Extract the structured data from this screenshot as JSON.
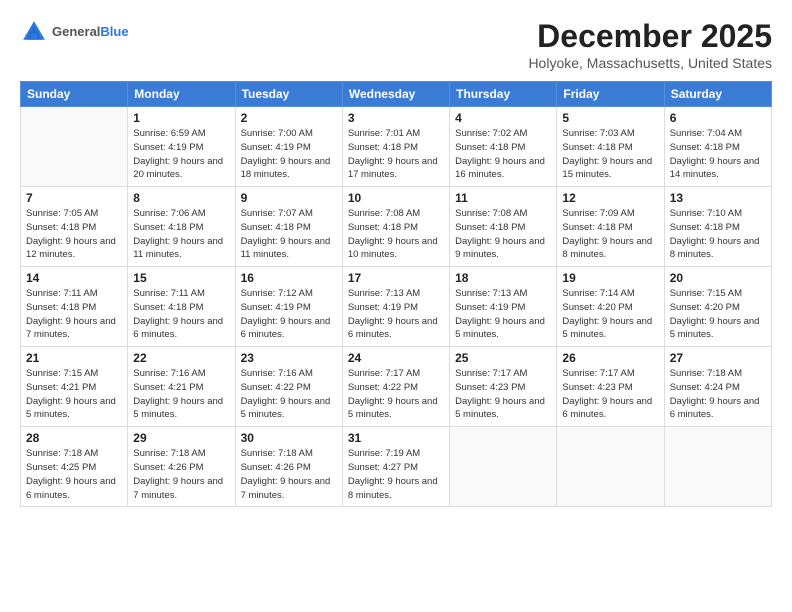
{
  "header": {
    "logo_general": "General",
    "logo_blue": "Blue",
    "month": "December 2025",
    "location": "Holyoke, Massachusetts, United States"
  },
  "days_of_week": [
    "Sunday",
    "Monday",
    "Tuesday",
    "Wednesday",
    "Thursday",
    "Friday",
    "Saturday"
  ],
  "weeks": [
    [
      {
        "day": "",
        "sunrise": "",
        "sunset": "",
        "daylight": ""
      },
      {
        "day": "1",
        "sunrise": "Sunrise: 6:59 AM",
        "sunset": "Sunset: 4:19 PM",
        "daylight": "Daylight: 9 hours and 20 minutes."
      },
      {
        "day": "2",
        "sunrise": "Sunrise: 7:00 AM",
        "sunset": "Sunset: 4:19 PM",
        "daylight": "Daylight: 9 hours and 18 minutes."
      },
      {
        "day": "3",
        "sunrise": "Sunrise: 7:01 AM",
        "sunset": "Sunset: 4:18 PM",
        "daylight": "Daylight: 9 hours and 17 minutes."
      },
      {
        "day": "4",
        "sunrise": "Sunrise: 7:02 AM",
        "sunset": "Sunset: 4:18 PM",
        "daylight": "Daylight: 9 hours and 16 minutes."
      },
      {
        "day": "5",
        "sunrise": "Sunrise: 7:03 AM",
        "sunset": "Sunset: 4:18 PM",
        "daylight": "Daylight: 9 hours and 15 minutes."
      },
      {
        "day": "6",
        "sunrise": "Sunrise: 7:04 AM",
        "sunset": "Sunset: 4:18 PM",
        "daylight": "Daylight: 9 hours and 14 minutes."
      }
    ],
    [
      {
        "day": "7",
        "sunrise": "Sunrise: 7:05 AM",
        "sunset": "Sunset: 4:18 PM",
        "daylight": "Daylight: 9 hours and 12 minutes."
      },
      {
        "day": "8",
        "sunrise": "Sunrise: 7:06 AM",
        "sunset": "Sunset: 4:18 PM",
        "daylight": "Daylight: 9 hours and 11 minutes."
      },
      {
        "day": "9",
        "sunrise": "Sunrise: 7:07 AM",
        "sunset": "Sunset: 4:18 PM",
        "daylight": "Daylight: 9 hours and 11 minutes."
      },
      {
        "day": "10",
        "sunrise": "Sunrise: 7:08 AM",
        "sunset": "Sunset: 4:18 PM",
        "daylight": "Daylight: 9 hours and 10 minutes."
      },
      {
        "day": "11",
        "sunrise": "Sunrise: 7:08 AM",
        "sunset": "Sunset: 4:18 PM",
        "daylight": "Daylight: 9 hours and 9 minutes."
      },
      {
        "day": "12",
        "sunrise": "Sunrise: 7:09 AM",
        "sunset": "Sunset: 4:18 PM",
        "daylight": "Daylight: 9 hours and 8 minutes."
      },
      {
        "day": "13",
        "sunrise": "Sunrise: 7:10 AM",
        "sunset": "Sunset: 4:18 PM",
        "daylight": "Daylight: 9 hours and 8 minutes."
      }
    ],
    [
      {
        "day": "14",
        "sunrise": "Sunrise: 7:11 AM",
        "sunset": "Sunset: 4:18 PM",
        "daylight": "Daylight: 9 hours and 7 minutes."
      },
      {
        "day": "15",
        "sunrise": "Sunrise: 7:11 AM",
        "sunset": "Sunset: 4:18 PM",
        "daylight": "Daylight: 9 hours and 6 minutes."
      },
      {
        "day": "16",
        "sunrise": "Sunrise: 7:12 AM",
        "sunset": "Sunset: 4:19 PM",
        "daylight": "Daylight: 9 hours and 6 minutes."
      },
      {
        "day": "17",
        "sunrise": "Sunrise: 7:13 AM",
        "sunset": "Sunset: 4:19 PM",
        "daylight": "Daylight: 9 hours and 6 minutes."
      },
      {
        "day": "18",
        "sunrise": "Sunrise: 7:13 AM",
        "sunset": "Sunset: 4:19 PM",
        "daylight": "Daylight: 9 hours and 5 minutes."
      },
      {
        "day": "19",
        "sunrise": "Sunrise: 7:14 AM",
        "sunset": "Sunset: 4:20 PM",
        "daylight": "Daylight: 9 hours and 5 minutes."
      },
      {
        "day": "20",
        "sunrise": "Sunrise: 7:15 AM",
        "sunset": "Sunset: 4:20 PM",
        "daylight": "Daylight: 9 hours and 5 minutes."
      }
    ],
    [
      {
        "day": "21",
        "sunrise": "Sunrise: 7:15 AM",
        "sunset": "Sunset: 4:21 PM",
        "daylight": "Daylight: 9 hours and 5 minutes."
      },
      {
        "day": "22",
        "sunrise": "Sunrise: 7:16 AM",
        "sunset": "Sunset: 4:21 PM",
        "daylight": "Daylight: 9 hours and 5 minutes."
      },
      {
        "day": "23",
        "sunrise": "Sunrise: 7:16 AM",
        "sunset": "Sunset: 4:22 PM",
        "daylight": "Daylight: 9 hours and 5 minutes."
      },
      {
        "day": "24",
        "sunrise": "Sunrise: 7:17 AM",
        "sunset": "Sunset: 4:22 PM",
        "daylight": "Daylight: 9 hours and 5 minutes."
      },
      {
        "day": "25",
        "sunrise": "Sunrise: 7:17 AM",
        "sunset": "Sunset: 4:23 PM",
        "daylight": "Daylight: 9 hours and 5 minutes."
      },
      {
        "day": "26",
        "sunrise": "Sunrise: 7:17 AM",
        "sunset": "Sunset: 4:23 PM",
        "daylight": "Daylight: 9 hours and 6 minutes."
      },
      {
        "day": "27",
        "sunrise": "Sunrise: 7:18 AM",
        "sunset": "Sunset: 4:24 PM",
        "daylight": "Daylight: 9 hours and 6 minutes."
      }
    ],
    [
      {
        "day": "28",
        "sunrise": "Sunrise: 7:18 AM",
        "sunset": "Sunset: 4:25 PM",
        "daylight": "Daylight: 9 hours and 6 minutes."
      },
      {
        "day": "29",
        "sunrise": "Sunrise: 7:18 AM",
        "sunset": "Sunset: 4:26 PM",
        "daylight": "Daylight: 9 hours and 7 minutes."
      },
      {
        "day": "30",
        "sunrise": "Sunrise: 7:18 AM",
        "sunset": "Sunset: 4:26 PM",
        "daylight": "Daylight: 9 hours and 7 minutes."
      },
      {
        "day": "31",
        "sunrise": "Sunrise: 7:19 AM",
        "sunset": "Sunset: 4:27 PM",
        "daylight": "Daylight: 9 hours and 8 minutes."
      },
      {
        "day": "",
        "sunrise": "",
        "sunset": "",
        "daylight": ""
      },
      {
        "day": "",
        "sunrise": "",
        "sunset": "",
        "daylight": ""
      },
      {
        "day": "",
        "sunrise": "",
        "sunset": "",
        "daylight": ""
      }
    ]
  ]
}
